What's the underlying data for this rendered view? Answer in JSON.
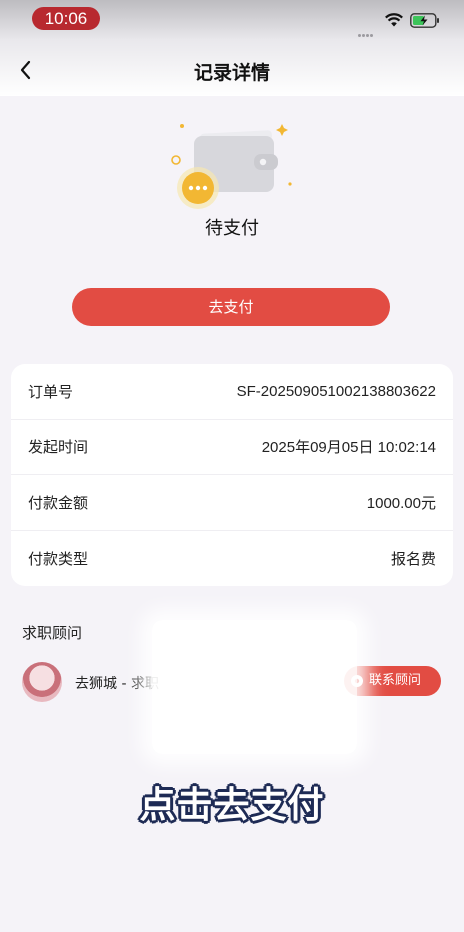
{
  "status_bar": {
    "time": "10:06"
  },
  "nav": {
    "title": "记录详情",
    "back_icon": "chevron-left-icon"
  },
  "order_status": {
    "text": "待支付",
    "illustration_icon": "wallet-icon"
  },
  "pay_button": {
    "label": "去支付",
    "color": "#e24c43"
  },
  "info_rows": [
    {
      "label": "订单号",
      "value": "SF-20250905100213880362​2"
    },
    {
      "label": "发起时间",
      "value": "2025年09月05日 10:02:14"
    },
    {
      "label": "付款金额",
      "value": "1000.00元"
    },
    {
      "label": "付款类型",
      "value": "报名费"
    }
  ],
  "consultant_section": {
    "title": "求职顾问",
    "name": "去狮城 - 求职",
    "contact_label": "联系顾问"
  },
  "caption": "点击去支付"
}
